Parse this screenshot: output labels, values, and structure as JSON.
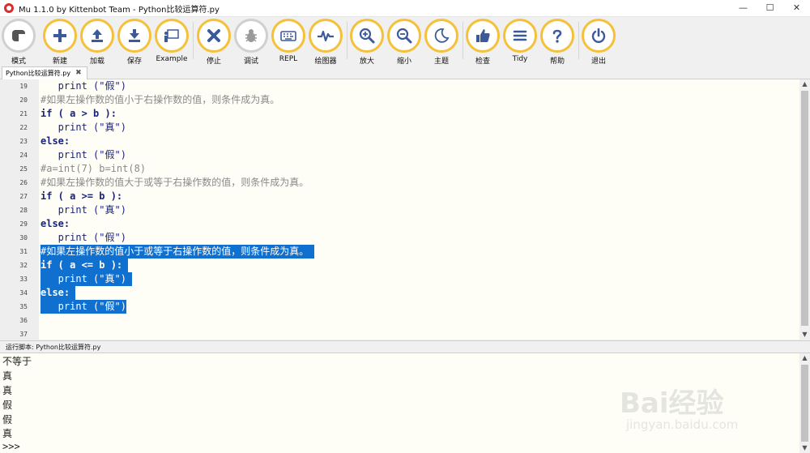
{
  "window": {
    "title": "Mu 1.1.0 by Kittenbot Team - Python比较运算符.py",
    "controls": {
      "minimize": "—",
      "maximize": "☐",
      "close": "✕"
    }
  },
  "toolbar": {
    "buttons": [
      {
        "label": "模式",
        "icon": "mode-icon"
      },
      {
        "label": "新建",
        "icon": "plus-icon"
      },
      {
        "label": "加载",
        "icon": "upload-icon"
      },
      {
        "label": "保存",
        "icon": "download-icon"
      },
      {
        "label": "Example",
        "icon": "presentation-icon"
      },
      {
        "label": "停止",
        "icon": "close-icon"
      },
      {
        "label": "调试",
        "icon": "bug-icon"
      },
      {
        "label": "REPL",
        "icon": "keyboard-icon"
      },
      {
        "label": "绘图器",
        "icon": "pulse-icon"
      },
      {
        "label": "放大",
        "icon": "zoom-in-icon"
      },
      {
        "label": "缩小",
        "icon": "zoom-out-icon"
      },
      {
        "label": "主题",
        "icon": "moon-icon"
      },
      {
        "label": "检查",
        "icon": "thumbs-up-icon"
      },
      {
        "label": "Tidy",
        "icon": "lines-icon"
      },
      {
        "label": "帮助",
        "icon": "question-icon"
      },
      {
        "label": "退出",
        "icon": "power-icon"
      }
    ]
  },
  "tabs": [
    {
      "label": "Python比较运算符.py",
      "close": "✖"
    }
  ],
  "editor": {
    "lines": [
      {
        "num": "19",
        "text": "   print (\"假\")",
        "style": "fn",
        "selected": false
      },
      {
        "num": "20",
        "text": "#如果左操作数的值小于右操作数的值，则条件成为真。",
        "style": "cmt",
        "selected": false
      },
      {
        "num": "21",
        "text": "if ( a > b ):",
        "style": "kw",
        "selected": false
      },
      {
        "num": "22",
        "text": "   print (\"真\")",
        "style": "fn",
        "selected": false
      },
      {
        "num": "23",
        "text": "else:",
        "style": "kw",
        "selected": false
      },
      {
        "num": "24",
        "text": "   print (\"假\")",
        "style": "fn",
        "selected": false
      },
      {
        "num": "25",
        "text": "#a=int(7) b=int(8)",
        "style": "cmt",
        "selected": false
      },
      {
        "num": "26",
        "text": "#如果左操作数的值大于或等于右操作数的值，则条件成为真。",
        "style": "cmt",
        "selected": false
      },
      {
        "num": "27",
        "text": "if ( a >= b ):",
        "style": "kw",
        "selected": false
      },
      {
        "num": "28",
        "text": "   print (\"真\")",
        "style": "fn",
        "selected": false
      },
      {
        "num": "29",
        "text": "else:",
        "style": "kw",
        "selected": false
      },
      {
        "num": "30",
        "text": "   print (\"假\")",
        "style": "fn",
        "selected": false
      },
      {
        "num": "31",
        "text": "#如果左操作数的值小于或等于右操作数的值，则条件成为真。 ",
        "style": "cmt",
        "selected": true
      },
      {
        "num": "32",
        "text": "if ( a <= b ): ",
        "style": "kw",
        "selected": true
      },
      {
        "num": "33",
        "text": "   print (\"真\") ",
        "style": "fn",
        "selected": true
      },
      {
        "num": "34",
        "text": "else: ",
        "style": "kw",
        "selected": true
      },
      {
        "num": "35",
        "text": "   print (\"假\")",
        "style": "fn",
        "selected": true
      },
      {
        "num": "36",
        "text": "",
        "style": "fn",
        "selected": false
      },
      {
        "num": "37",
        "text": "",
        "style": "fn",
        "selected": false
      }
    ]
  },
  "run_pane": {
    "header": "运行脚本: Python比较运算符.py",
    "output": [
      "不等于",
      "真",
      "真",
      "假",
      "假",
      "真",
      ">>>"
    ]
  },
  "watermark": {
    "brand": "Bai经验",
    "url": "jingyan.baidu.com"
  },
  "colors": {
    "accent": "#f5c13a",
    "selection": "#1070d0",
    "editor_bg": "#fefef7"
  }
}
